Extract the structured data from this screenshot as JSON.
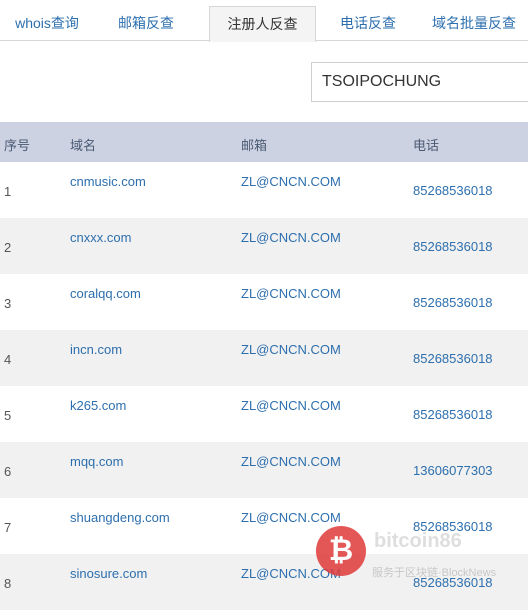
{
  "tabs": [
    {
      "label": "whois查询"
    },
    {
      "label": "邮箱反查"
    },
    {
      "label": "注册人反查"
    },
    {
      "label": "电话反查"
    },
    {
      "label": "域名批量反查"
    }
  ],
  "search": {
    "value": "TSOIPOCHUNG"
  },
  "table": {
    "headers": {
      "num": "序号",
      "domain": "域名",
      "email": "邮箱",
      "phone": "电话"
    },
    "rows": [
      {
        "num": "1",
        "domain": "cnmusic.com",
        "email": "ZL@CNCN.COM",
        "phone": "85268536018"
      },
      {
        "num": "2",
        "domain": "cnxxx.com",
        "email": "ZL@CNCN.COM",
        "phone": "85268536018"
      },
      {
        "num": "3",
        "domain": "coralqq.com",
        "email": "ZL@CNCN.COM",
        "phone": "85268536018"
      },
      {
        "num": "4",
        "domain": "incn.com",
        "email": "ZL@CNCN.COM",
        "phone": "85268536018"
      },
      {
        "num": "5",
        "domain": "k265.com",
        "email": "ZL@CNCN.COM",
        "phone": "85268536018"
      },
      {
        "num": "6",
        "domain": "mqq.com",
        "email": "ZL@CNCN.COM",
        "phone": "13606077303"
      },
      {
        "num": "7",
        "domain": "shuangdeng.com",
        "email": "ZL@CNCN.COM",
        "phone": "85268536018"
      },
      {
        "num": "8",
        "domain": "sinosure.com",
        "email": "ZL@CNCN.COM",
        "phone": "85268536018"
      }
    ]
  },
  "watermark": {
    "brand": "bitcoin86",
    "tagline": "服务于区块链·BlockNews"
  }
}
